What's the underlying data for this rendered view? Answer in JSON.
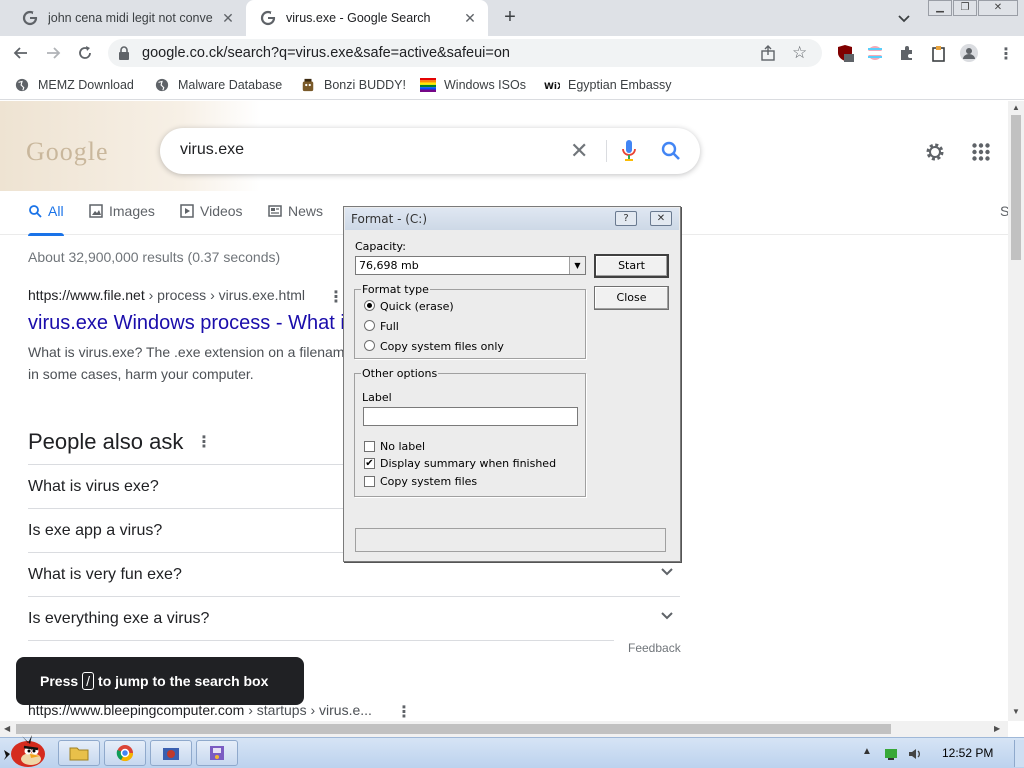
{
  "browser": {
    "tabs": [
      {
        "title": "john cena midi legit not conve",
        "active": false
      },
      {
        "title": "virus.exe - Google Search",
        "active": true
      }
    ],
    "url": "google.co.ck/search?q=virus.exe&safe=active&safeui=on",
    "extension_badge": "7",
    "bookmarks": [
      {
        "label": "MEMZ Download",
        "icon": "globe-icon"
      },
      {
        "label": "Malware Database",
        "icon": "globe-icon"
      },
      {
        "label": "Bonzi BUDDY!",
        "icon": "bonzi-icon"
      },
      {
        "label": "Windows ISOs",
        "icon": "rainbow-flag-icon"
      },
      {
        "label": "Egyptian Embassy",
        "icon": "wix-icon"
      }
    ]
  },
  "google": {
    "logo_text": "Google",
    "query": "virus.exe",
    "tabs": [
      {
        "label": "All",
        "active": true
      },
      {
        "label": "Images"
      },
      {
        "label": "Videos"
      },
      {
        "label": "News"
      },
      {
        "label": "S"
      }
    ],
    "stats": "About 32,900,000 results (0.37 seconds)",
    "result1": {
      "site": "https://www.file.net",
      "path": " › process › virus.exe.html",
      "title": "virus.exe Windows process - What is",
      "snippet": "What is virus.exe? The .exe extension on a filename may, in some cases, harm your computer."
    },
    "people_also_ask": {
      "heading": "People also ask",
      "questions": [
        "What is virus exe?",
        "Is exe app a virus?",
        "What is very fun exe?",
        "Is everything exe a virus?"
      ],
      "feedback": "Feedback"
    },
    "result2": {
      "site": "https://www.bleepingcomputer.com",
      "path": " › startups › virus.e..."
    },
    "toast": {
      "prefix": "Press",
      "key": "/",
      "suffix": "to jump to the search box"
    }
  },
  "format_dialog": {
    "title": "Format -  (C:)",
    "help_btn": "?",
    "close_btn": "✕",
    "capacity_label": "Capacity:",
    "capacity_value": "76,698 mb",
    "start": "Start",
    "close": "Close",
    "format_type_label": "Format type",
    "format_types": [
      {
        "label": "Quick (erase)",
        "selected": true
      },
      {
        "label": "Full",
        "selected": false
      },
      {
        "label": "Copy system files only",
        "selected": false
      }
    ],
    "other_options_label": "Other options",
    "label_caption": "Label",
    "label_value": "",
    "options": [
      {
        "label": "No label",
        "checked": false
      },
      {
        "label": "Display summary when finished",
        "checked": true
      },
      {
        "label": "Copy system files",
        "checked": false
      }
    ]
  },
  "taskbar": {
    "clock": "12:52 PM"
  },
  "colors": {
    "google_blue": "#1a73e8",
    "link": "#1a0dab",
    "taskbar": "#bcd2ee"
  }
}
